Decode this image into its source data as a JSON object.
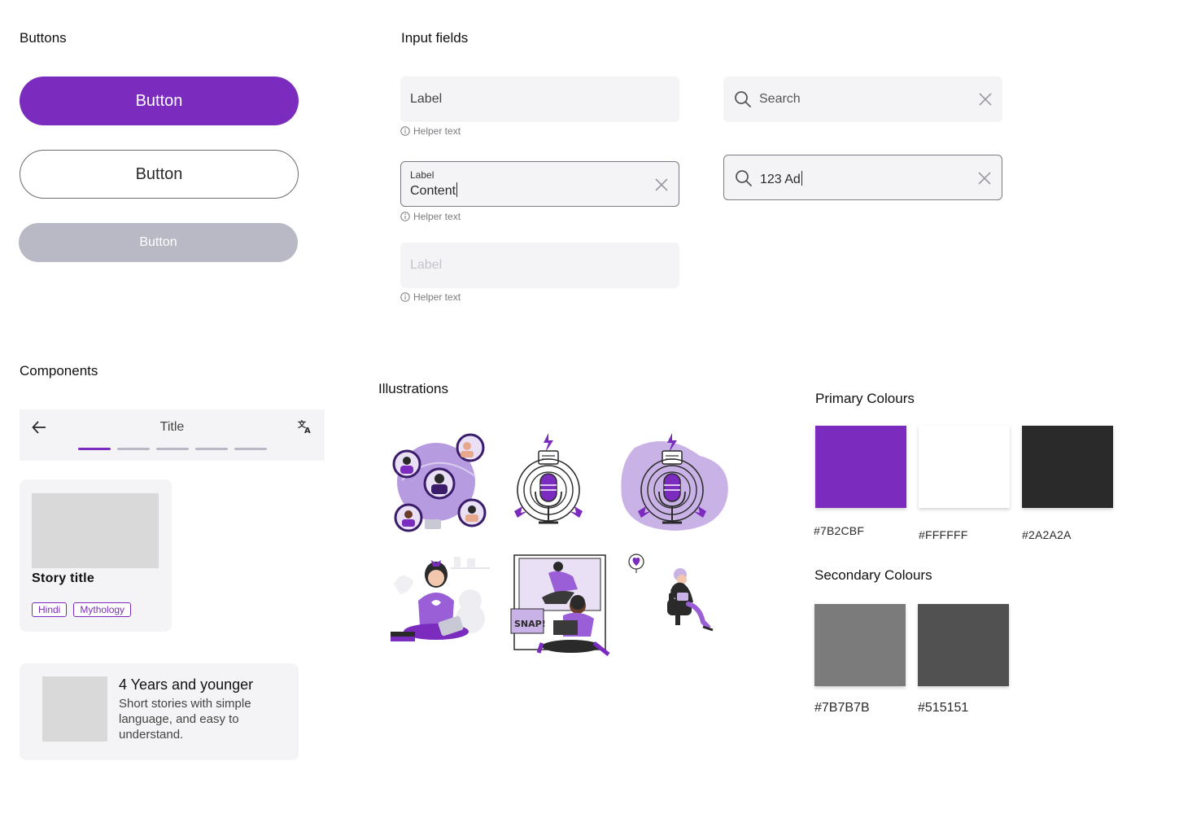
{
  "buttons": {
    "section_title": "Buttons",
    "primary_label": "Button",
    "outline_label": "Button",
    "disabled_label": "Button"
  },
  "inputs": {
    "section_title": "Input fields",
    "default_label": "Label",
    "default_helper": "Helper text",
    "active_label": "Label",
    "active_value": "Content",
    "active_helper": "Helper text",
    "disabled_label": "Label",
    "disabled_helper": "Helper text",
    "search_placeholder": "Search",
    "search_active_value": "123 Ad"
  },
  "components": {
    "section_title": "Components",
    "appbar_title": "Title",
    "progress_steps": 5,
    "progress_active": 1,
    "story_title": "Story title",
    "story_tags": [
      "Hindi",
      "Mythology"
    ],
    "age_title": "4 Years and younger",
    "age_description": "Short stories with simple language, and easy to understand."
  },
  "illustrations": {
    "section_title": "Illustrations",
    "items": [
      "people-network-illustration",
      "podcast-microphone-illustration",
      "podcast-microphone-blob-illustration",
      "girl-reading-illustration",
      "kids-comic-reading-illustration",
      "woman-armchair-illustration"
    ]
  },
  "colours": {
    "primary_title": "Primary Colours",
    "primary": [
      {
        "hex": "#7B2CBF",
        "label": "#7B2CBF"
      },
      {
        "hex": "#FFFFFF",
        "label": "#FFFFFF"
      },
      {
        "hex": "#2A2A2A",
        "label": "#2A2A2A"
      }
    ],
    "secondary_title": "Secondary Colours",
    "secondary": [
      {
        "hex": "#7B7B7B",
        "label": "#7B7B7B"
      },
      {
        "hex": "#515151",
        "label": "#515151"
      }
    ]
  },
  "theme": {
    "accent": "#7B2CBF",
    "accent_light": "#C9B3E6",
    "disabled": "#B9B9C6",
    "field_bg": "#F4F4F6"
  }
}
